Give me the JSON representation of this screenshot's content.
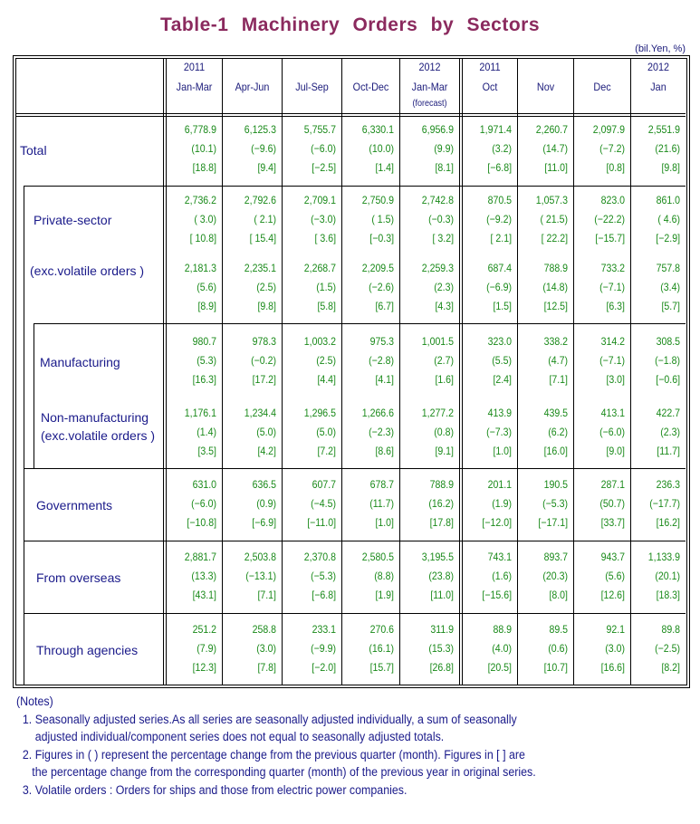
{
  "title": "Table-1   Machinery   Orders   by   Sectors",
  "unit": "(bil.Yen, %)",
  "columns": [
    {
      "line1": "2011",
      "line2": "Jan-Mar",
      "line3": ""
    },
    {
      "line1": "",
      "line2": "Apr-Jun",
      "line3": ""
    },
    {
      "line1": "",
      "line2": "Jul-Sep",
      "line3": ""
    },
    {
      "line1": "",
      "line2": "Oct-Dec",
      "line3": ""
    },
    {
      "line1": "2012",
      "line2": "Jan-Mar",
      "line3": "(forecast)"
    },
    {
      "line1": "2011",
      "line2": "Oct",
      "line3": ""
    },
    {
      "line1": "",
      "line2": "Nov",
      "line3": ""
    },
    {
      "line1": "",
      "line2": "Dec",
      "line3": ""
    },
    {
      "line1": "2012",
      "line2": "Jan",
      "line3": ""
    }
  ],
  "rows": [
    {
      "label": "Total",
      "values": [
        [
          "6,778.9",
          "(10.1)",
          "[18.8]"
        ],
        [
          "6,125.3",
          "(−9.6)",
          "[9.4]"
        ],
        [
          "5,755.7",
          "(−6.0)",
          "[−2.5]"
        ],
        [
          "6,330.1",
          "(10.0)",
          "[1.4]"
        ],
        [
          "6,956.9",
          "(9.9)",
          "[8.1]"
        ],
        [
          "1,971.4",
          "(3.2)",
          "[−6.8]"
        ],
        [
          "2,260.7",
          "(14.7)",
          "[11.0]"
        ],
        [
          "2,097.9",
          "(−7.2)",
          "[0.8]"
        ],
        [
          "2,551.9",
          "(21.6)",
          "[9.8]"
        ]
      ]
    },
    {
      "label": "Private-sector",
      "values": [
        [
          "2,736.2",
          "( 3.0)",
          "[ 10.8]"
        ],
        [
          "2,792.6",
          "( 2.1)",
          "[ 15.4]"
        ],
        [
          "2,709.1",
          "(−3.0)",
          "[ 3.6]"
        ],
        [
          "2,750.9",
          "( 1.5)",
          "[−0.3]"
        ],
        [
          "2,742.8",
          "(−0.3)",
          "[ 3.2]"
        ],
        [
          "870.5",
          "(−9.2)",
          "[ 2.1]"
        ],
        [
          "1,057.3",
          "( 21.5)",
          "[ 22.2]"
        ],
        [
          "823.0",
          "(−22.2)",
          "[−15.7]"
        ],
        [
          "861.0",
          "( 4.6)",
          "[−2.9]"
        ]
      ]
    },
    {
      "label": "(exc.volatile orders )",
      "values": [
        [
          "2,181.3",
          "(5.6)",
          "[8.9]"
        ],
        [
          "2,235.1",
          "(2.5)",
          "[9.8]"
        ],
        [
          "2,268.7",
          "(1.5)",
          "[5.8]"
        ],
        [
          "2,209.5",
          "(−2.6)",
          "[6.7]"
        ],
        [
          "2,259.3",
          "(2.3)",
          "[4.3]"
        ],
        [
          "687.4",
          "(−6.9)",
          "[1.5]"
        ],
        [
          "788.9",
          "(14.8)",
          "[12.5]"
        ],
        [
          "733.2",
          "(−7.1)",
          "[6.3]"
        ],
        [
          "757.8",
          "(3.4)",
          "[5.7]"
        ]
      ]
    },
    {
      "label": "Manufacturing",
      "values": [
        [
          "980.7",
          "(5.3)",
          "[16.3]"
        ],
        [
          "978.3",
          "(−0.2)",
          "[17.2]"
        ],
        [
          "1,003.2",
          "(2.5)",
          "[4.4]"
        ],
        [
          "975.3",
          "(−2.8)",
          "[4.1]"
        ],
        [
          "1,001.5",
          "(2.7)",
          "[1.6]"
        ],
        [
          "323.0",
          "(5.5)",
          "[2.4]"
        ],
        [
          "338.2",
          "(4.7)",
          "[7.1]"
        ],
        [
          "314.2",
          "(−7.1)",
          "[3.0]"
        ],
        [
          "308.5",
          "(−1.8)",
          "[−0.6]"
        ]
      ]
    },
    {
      "label": "Non-manufacturing\n(exc.volatile orders )",
      "values": [
        [
          "1,176.1",
          "(1.4)",
          "[3.5]"
        ],
        [
          "1,234.4",
          "(5.0)",
          "[4.2]"
        ],
        [
          "1,296.5",
          "(5.0)",
          "[7.2]"
        ],
        [
          "1,266.6",
          "(−2.3)",
          "[8.6]"
        ],
        [
          "1,277.2",
          "(0.8)",
          "[9.1]"
        ],
        [
          "413.9",
          "(−7.3)",
          "[1.0]"
        ],
        [
          "439.5",
          "(6.2)",
          "[16.0]"
        ],
        [
          "413.1",
          "(−6.0)",
          "[9.0]"
        ],
        [
          "422.7",
          "(2.3)",
          "[11.7]"
        ]
      ]
    },
    {
      "label": "Governments",
      "values": [
        [
          "631.0",
          "(−6.0)",
          "[−10.8]"
        ],
        [
          "636.5",
          "(0.9)",
          "[−6.9]"
        ],
        [
          "607.7",
          "(−4.5)",
          "[−11.0]"
        ],
        [
          "678.7",
          "(11.7)",
          "[1.0]"
        ],
        [
          "788.9",
          "(16.2)",
          "[17.8]"
        ],
        [
          "201.1",
          "(1.9)",
          "[−12.0]"
        ],
        [
          "190.5",
          "(−5.3)",
          "[−17.1]"
        ],
        [
          "287.1",
          "(50.7)",
          "[33.7]"
        ],
        [
          "236.3",
          "(−17.7)",
          "[16.2]"
        ]
      ]
    },
    {
      "label": "From overseas",
      "values": [
        [
          "2,881.7",
          "(13.3)",
          "[43.1]"
        ],
        [
          "2,503.8",
          "(−13.1)",
          "[7.1]"
        ],
        [
          "2,370.8",
          "(−5.3)",
          "[−6.8]"
        ],
        [
          "2,580.5",
          "(8.8)",
          "[1.9]"
        ],
        [
          "3,195.5",
          "(23.8)",
          "[11.0]"
        ],
        [
          "743.1",
          "(1.6)",
          "[−15.6]"
        ],
        [
          "893.7",
          "(20.3)",
          "[8.0]"
        ],
        [
          "943.7",
          "(5.6)",
          "[12.6]"
        ],
        [
          "1,133.9",
          "(20.1)",
          "[18.3]"
        ]
      ]
    },
    {
      "label": "Through agencies",
      "values": [
        [
          "251.2",
          "(7.9)",
          "[12.3]"
        ],
        [
          "258.8",
          "(3.0)",
          "[7.8]"
        ],
        [
          "233.1",
          "(−9.9)",
          "[−2.0]"
        ],
        [
          "270.6",
          "(16.1)",
          "[15.7]"
        ],
        [
          "311.9",
          "(15.3)",
          "[26.8]"
        ],
        [
          "88.9",
          "(4.0)",
          "[20.5]"
        ],
        [
          "89.5",
          "(0.6)",
          "[10.7]"
        ],
        [
          "92.1",
          "(3.0)",
          "[16.6]"
        ],
        [
          "89.8",
          "(−2.5)",
          "[8.2]"
        ]
      ]
    }
  ],
  "notes": {
    "heading": "(Notes)",
    "lines": [
      "  1. Seasonally adjusted series.As all series are seasonally adjusted individually, a sum of seasonally",
      "      adjusted individual/component series does not equal to seasonally adjusted totals.",
      "  2. Figures in ( ) represent the percentage change from the previous quarter (month). Figures in [ ] are",
      "     the percentage change from the corresponding quarter (month) of the previous year in original series.",
      "  3. Volatile orders : Orders for ships and those from electric power companies."
    ]
  }
}
